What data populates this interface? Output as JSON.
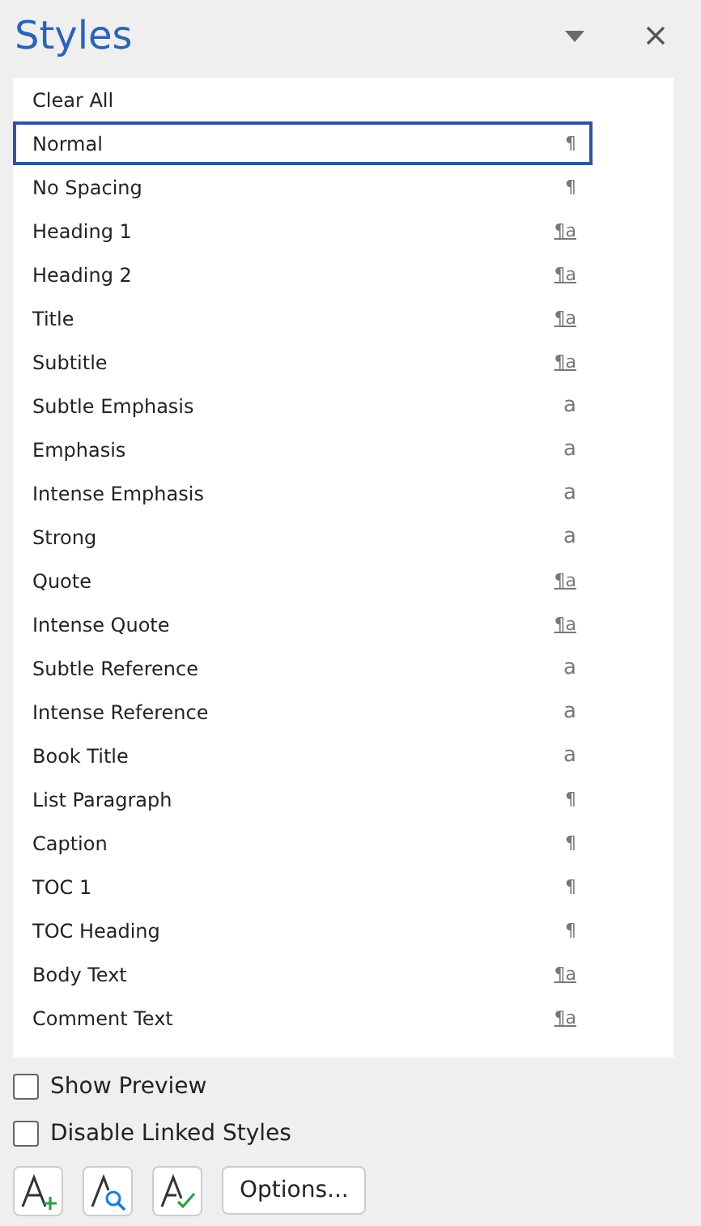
{
  "pane": {
    "title": "Styles"
  },
  "styles": [
    {
      "name": "Clear All",
      "selected": false
    },
    {
      "name": "Normal",
      "mark": "¶",
      "kind": "paragraph",
      "selected": true
    },
    {
      "name": "No Spacing",
      "mark": "¶",
      "kind": "paragraph",
      "selected": false
    },
    {
      "name": "Heading 1",
      "mark": "¶a",
      "kind": "linked",
      "selected": false
    },
    {
      "name": "Heading 2",
      "mark": "¶a",
      "kind": "linked",
      "selected": false
    },
    {
      "name": "Title",
      "mark": "¶a",
      "kind": "linked",
      "selected": false
    },
    {
      "name": "Subtitle",
      "mark": "¶a",
      "kind": "linked",
      "selected": false
    },
    {
      "name": "Subtle Emphasis",
      "mark": "a",
      "kind": "character",
      "selected": false
    },
    {
      "name": "Emphasis",
      "mark": "a",
      "kind": "character",
      "selected": false
    },
    {
      "name": "Intense Emphasis",
      "mark": "a",
      "kind": "character",
      "selected": false
    },
    {
      "name": "Strong",
      "mark": "a",
      "kind": "character",
      "selected": false
    },
    {
      "name": "Quote",
      "mark": "¶a",
      "kind": "linked",
      "selected": false
    },
    {
      "name": "Intense Quote",
      "mark": "¶a",
      "kind": "linked",
      "selected": false
    },
    {
      "name": "Subtle Reference",
      "mark": "a",
      "kind": "character",
      "selected": false
    },
    {
      "name": "Intense Reference",
      "mark": "a",
      "kind": "character",
      "selected": false
    },
    {
      "name": "Book Title",
      "mark": "a",
      "kind": "character",
      "selected": false
    },
    {
      "name": "List Paragraph",
      "mark": "¶",
      "kind": "paragraph",
      "selected": false
    },
    {
      "name": "Caption",
      "mark": "¶",
      "kind": "paragraph",
      "selected": false
    },
    {
      "name": "TOC 1",
      "mark": "¶",
      "kind": "paragraph",
      "selected": false
    },
    {
      "name": "TOC Heading",
      "mark": "¶",
      "kind": "paragraph",
      "selected": false
    },
    {
      "name": "Body Text",
      "mark": "¶a",
      "kind": "linked",
      "selected": false
    },
    {
      "name": "Comment Text",
      "mark": "¶a",
      "kind": "linked",
      "selected": false
    }
  ],
  "options": [
    {
      "label": "Show Preview",
      "checked": false
    },
    {
      "label": "Disable Linked Styles",
      "checked": false
    }
  ],
  "buttons": {
    "options": "Options..."
  }
}
